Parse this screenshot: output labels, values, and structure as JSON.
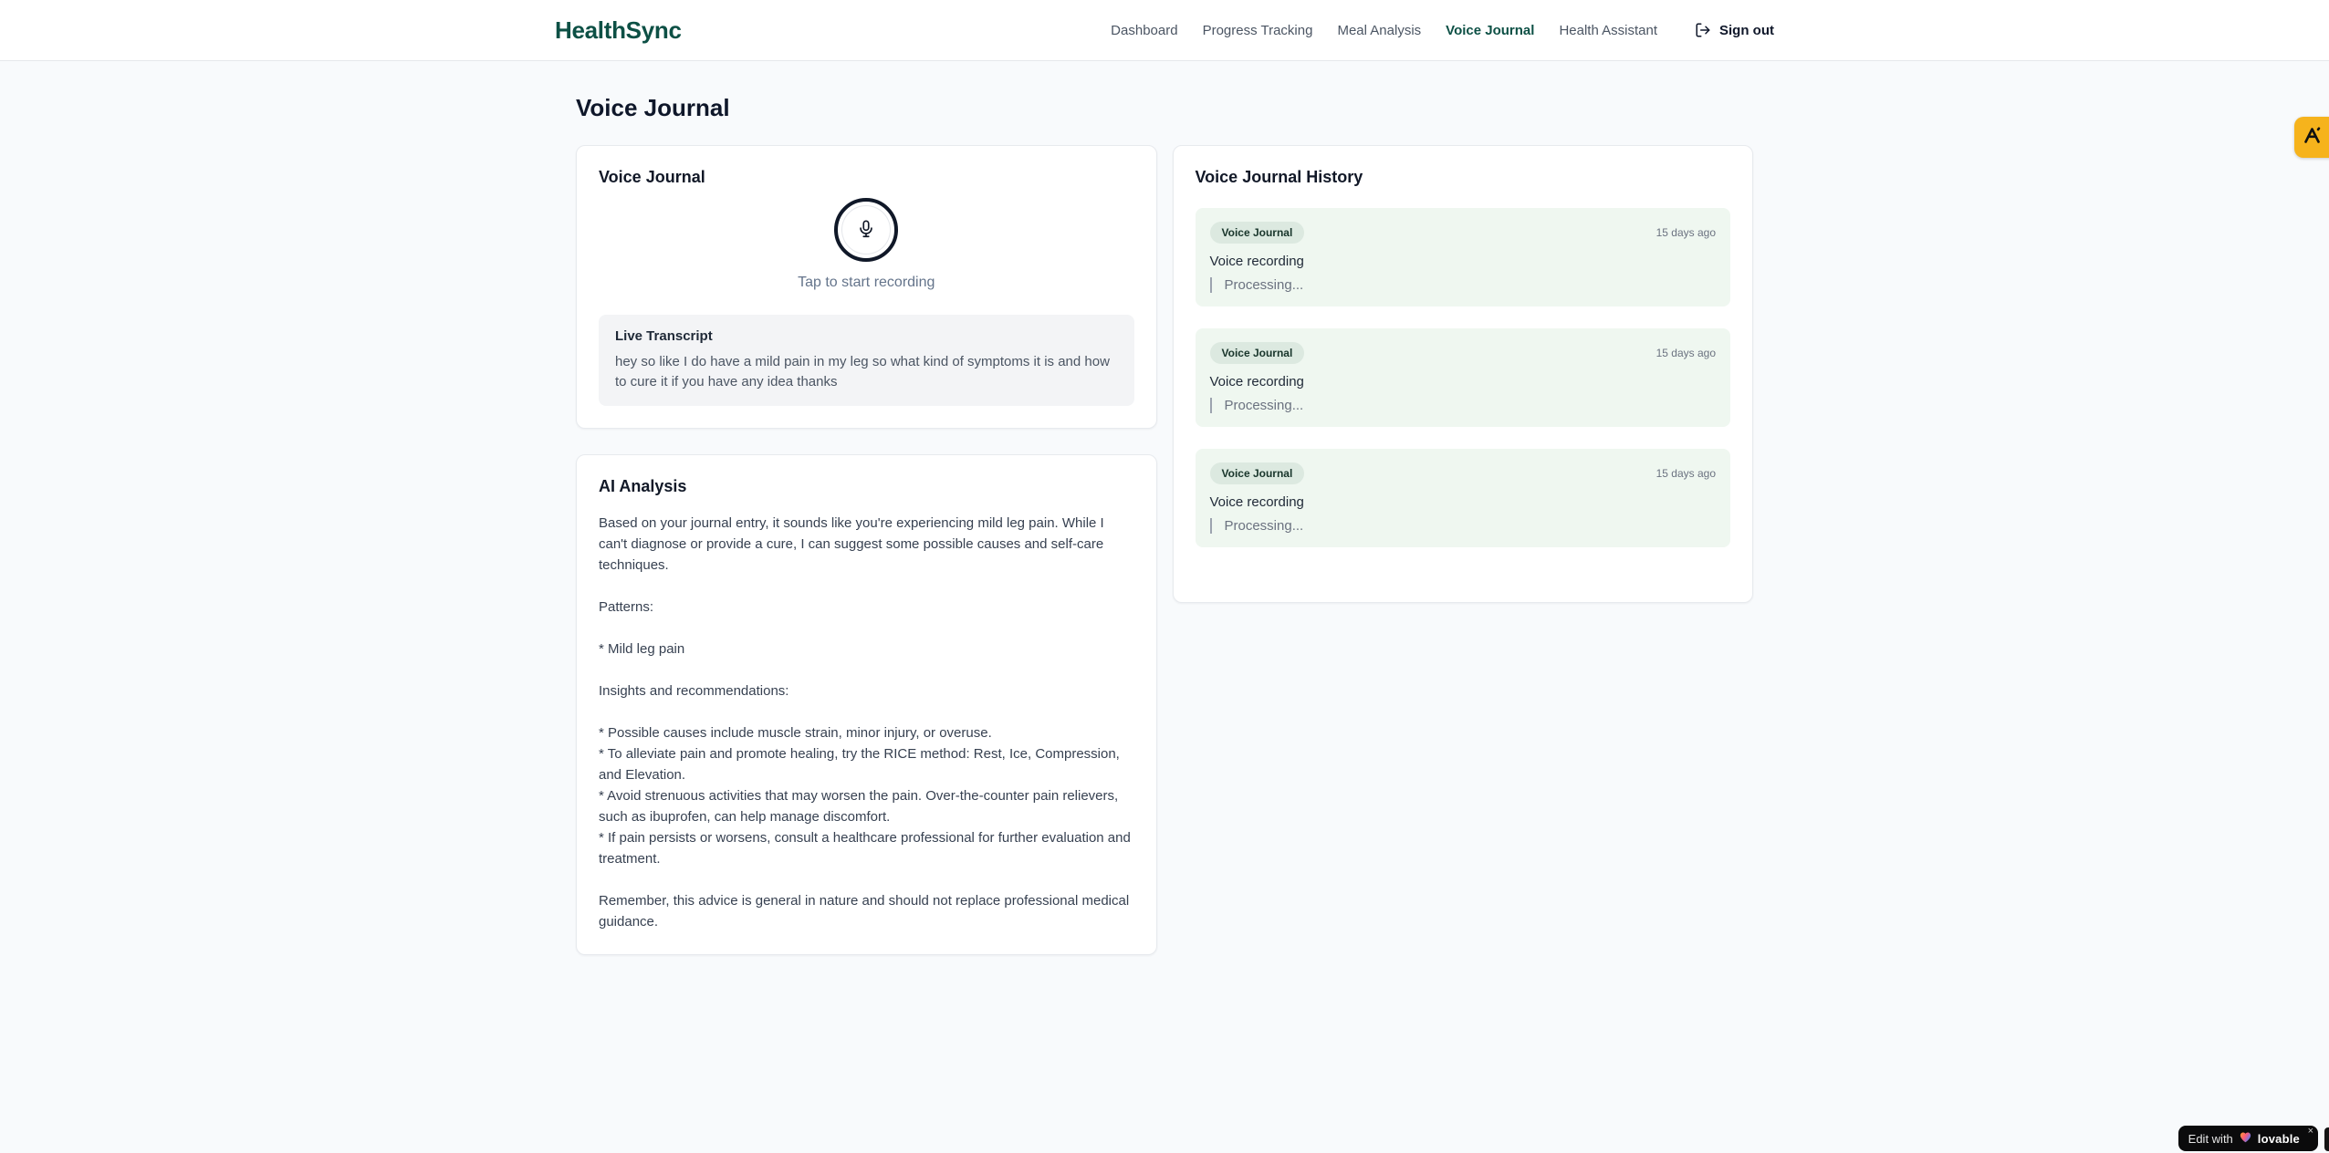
{
  "colors": {
    "brand": "#0d5045",
    "page_bg": "#f8fafc",
    "history_entry_bg": "#eff7f0",
    "badge_bg": "#dce9e0",
    "amber_badge_bg": "#f6b31c",
    "lovable_badge_bg": "#0b0b0c"
  },
  "header": {
    "brand": "HealthSync",
    "nav": {
      "items": [
        {
          "label": "Dashboard",
          "active": false
        },
        {
          "label": "Progress Tracking",
          "active": false
        },
        {
          "label": "Meal Analysis",
          "active": false
        },
        {
          "label": "Voice Journal",
          "active": true
        },
        {
          "label": "Health Assistant",
          "active": false
        }
      ],
      "sign_out_label": "Sign out"
    }
  },
  "page": {
    "title": "Voice Journal"
  },
  "recorder_card": {
    "title": "Voice Journal",
    "tap_hint": "Tap to start recording",
    "live_transcript": {
      "title": "Live Transcript",
      "text": "hey so like I do have a mild pain in my leg so what kind of symptoms it is and how to cure it if you have any idea thanks"
    }
  },
  "ai_card": {
    "title": "AI Analysis",
    "body": "Based on your journal entry, it sounds like you're experiencing mild leg pain. While I can't diagnose or provide a cure, I can suggest some possible causes and self-care techniques.\n\nPatterns:\n\n* Mild leg pain\n\nInsights and recommendations:\n\n* Possible causes include muscle strain, minor injury, or overuse.\n* To alleviate pain and promote healing, try the RICE method: Rest, Ice, Compression, and Elevation.\n* Avoid strenuous activities that may worsen the pain. Over-the-counter pain relievers, such as ibuprofen, can help manage discomfort.\n* If pain persists or worsens, consult a healthcare professional for further evaluation and treatment.\n\nRemember, this advice is general in nature and should not replace professional medical guidance."
  },
  "history_card": {
    "title": "Voice Journal History",
    "entries": [
      {
        "badge": "Voice Journal",
        "time": "15 days ago",
        "title": "Voice recording",
        "status": "Processing..."
      },
      {
        "badge": "Voice Journal",
        "time": "15 days ago",
        "title": "Voice recording",
        "status": "Processing..."
      },
      {
        "badge": "Voice Journal",
        "time": "15 days ago",
        "title": "Voice recording",
        "status": "Processing..."
      }
    ]
  },
  "overlays": {
    "edit_badge": {
      "prefix": "Edit with",
      "brand": "lovable",
      "close": "×"
    }
  }
}
